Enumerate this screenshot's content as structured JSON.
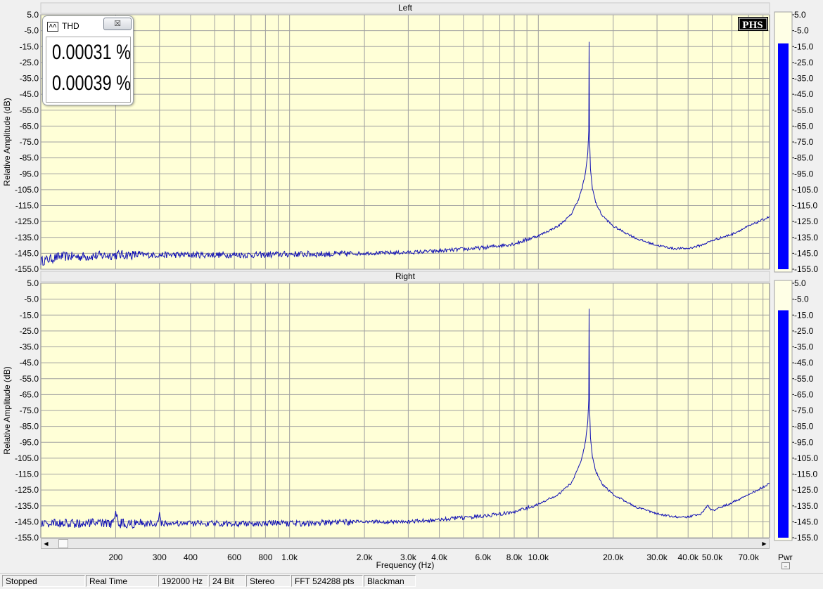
{
  "chart_data": [
    {
      "type": "line",
      "title": "Left",
      "xlabel": "Frequency (Hz)",
      "ylabel": "Relative Amplitude (dB)",
      "x_scale": "log",
      "xlim": [
        100,
        85000
      ],
      "ylim": [
        -155,
        5
      ],
      "grid": true,
      "y_ticks": [
        "5.0",
        "-5.0",
        "-15.0",
        "-25.0",
        "-35.0",
        "-45.0",
        "-55.0",
        "-65.0",
        "-75.0",
        "-85.0",
        "-95.0",
        "-105.0",
        "-115.0",
        "-125.0",
        "-135.0",
        "-145.0",
        "-155.0"
      ],
      "series": [
        {
          "x": [
            100,
            120,
            150,
            200,
            300,
            400,
            600,
            800,
            1000,
            1500,
            2000,
            3000,
            4000,
            6000,
            8000,
            10000,
            12000,
            13500,
            14500,
            15000,
            15500,
            15800,
            15950,
            16000,
            16050,
            16200,
            16500,
            17000,
            18000,
            20000,
            25000,
            30000,
            35000,
            40000,
            45000,
            50000,
            60000,
            70000,
            85000
          ],
          "y": [
            -150,
            -147,
            -147,
            -146,
            -146,
            -146,
            -146,
            -146,
            -145.5,
            -145.5,
            -145,
            -144.5,
            -143.5,
            -141.5,
            -139,
            -134,
            -128,
            -121,
            -111,
            -104,
            -94,
            -82,
            -68,
            -12,
            -70,
            -92,
            -104,
            -113,
            -121,
            -128,
            -136,
            -140,
            -142,
            -142,
            -140,
            -137,
            -133,
            -128,
            -122
          ]
        }
      ],
      "bar_level_top": -13
    },
    {
      "type": "line",
      "title": "Right",
      "xlabel": "Frequency (Hz)",
      "ylabel": "Relative Amplitude (dB)",
      "x_scale": "log",
      "xlim": [
        100,
        85000
      ],
      "ylim": [
        -155,
        5
      ],
      "grid": true,
      "y_ticks": [
        "5.0",
        "-5.0",
        "-15.0",
        "-25.0",
        "-35.0",
        "-45.0",
        "-55.0",
        "-65.0",
        "-75.0",
        "-85.0",
        "-95.0",
        "-105.0",
        "-115.0",
        "-125.0",
        "-135.0",
        "-145.0",
        "-155.0"
      ],
      "series": [
        {
          "x": [
            100,
            120,
            150,
            195,
            200,
            205,
            250,
            295,
            300,
            305,
            400,
            600,
            800,
            1000,
            1500,
            2000,
            3000,
            4000,
            6000,
            8000,
            10000,
            12000,
            13500,
            14500,
            15000,
            15500,
            15800,
            15950,
            16000,
            16050,
            16200,
            16500,
            17000,
            18000,
            20000,
            25000,
            30000,
            35000,
            40000,
            45000,
            48000,
            50000,
            60000,
            70000,
            85000
          ],
          "y": [
            -146,
            -146,
            -146,
            -146,
            -137,
            -146,
            -146,
            -146,
            -138,
            -146,
            -146,
            -146,
            -146,
            -146,
            -145.5,
            -145,
            -145,
            -143.5,
            -141.5,
            -139,
            -134,
            -128,
            -121,
            -111,
            -104,
            -94,
            -82,
            -68,
            -11,
            -70,
            -92,
            -104,
            -113,
            -121,
            -128,
            -136,
            -140,
            -142,
            -142,
            -140,
            -135,
            -138,
            -133,
            -128,
            -121
          ]
        }
      ],
      "bar_level_top": -12
    }
  ],
  "x_tick_labels": [
    {
      "f": 200,
      "label": "200"
    },
    {
      "f": 300,
      "label": "300"
    },
    {
      "f": 400,
      "label": "400"
    },
    {
      "f": 600,
      "label": "600"
    },
    {
      "f": 800,
      "label": "800"
    },
    {
      "f": 1000,
      "label": "1.0k"
    },
    {
      "f": 2000,
      "label": "2.0k"
    },
    {
      "f": 3000,
      "label": "3.0k"
    },
    {
      "f": 4000,
      "label": "4.0k"
    },
    {
      "f": 6000,
      "label": "6.0k"
    },
    {
      "f": 8000,
      "label": "8.0k"
    },
    {
      "f": 10000,
      "label": "10.0k"
    },
    {
      "f": 20000,
      "label": "20.0k"
    },
    {
      "f": 30000,
      "label": "30.0k"
    },
    {
      "f": 40000,
      "label": "40.0k"
    },
    {
      "f": 50000,
      "label": "50.0k"
    },
    {
      "f": 70000,
      "label": "70.0k"
    }
  ],
  "colors": {
    "plot_background": "#ffffd7",
    "grid": "#a0a0a0",
    "trace": "#1010b4",
    "meter_fill": "#0000ff",
    "meter_background": "#ffffe6"
  },
  "watermark": "PHS",
  "thd_window": {
    "icon": "waveform-icon",
    "title": "THD",
    "close_symbol": "☒",
    "value_left": "0.00031 %",
    "value_right": "0.00039 %"
  },
  "meter_label": "Pwr",
  "status_bar": [
    "Stopped",
    "Real Time",
    "192000 Hz",
    "24 Bit",
    "Stereo",
    "FFT 524288 pts",
    "Blackman"
  ]
}
